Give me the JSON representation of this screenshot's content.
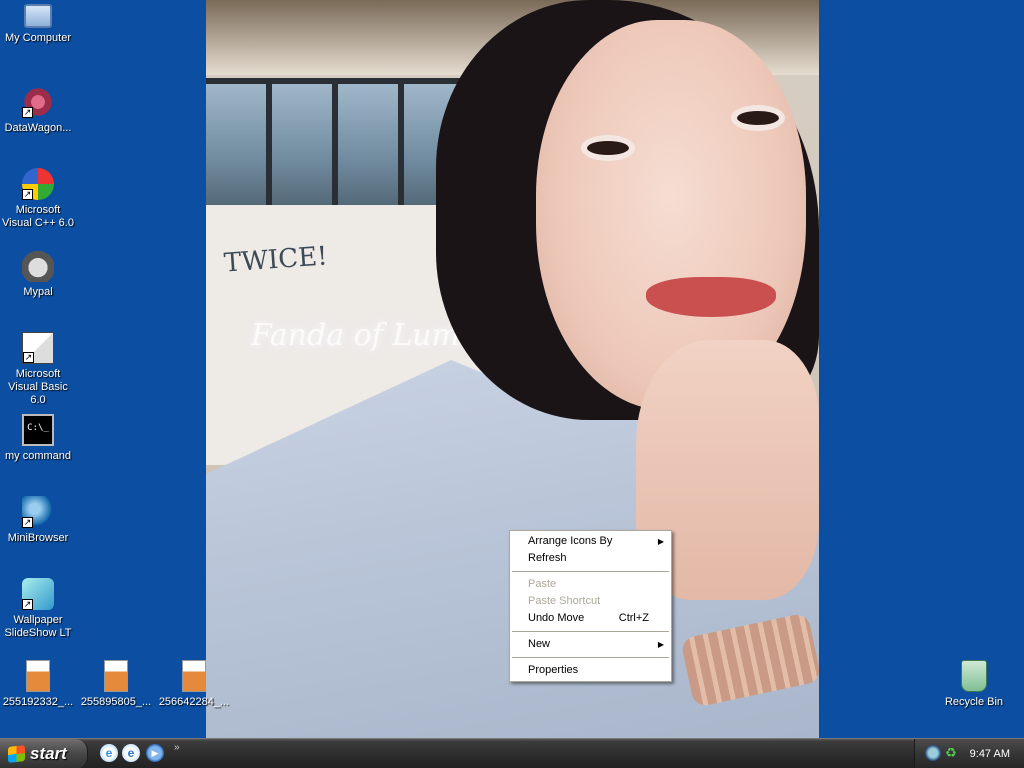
{
  "desktop": {
    "icons": [
      {
        "label": "My Computer",
        "icon": "my-computer-icon"
      },
      {
        "label": "DataWagon...",
        "icon": "datawagon-icon"
      },
      {
        "label": "Microsoft Visual C++ 6.0",
        "icon": "visual-cpp-icon"
      },
      {
        "label": "Mypal",
        "icon": "mypal-icon"
      },
      {
        "label": "Microsoft Visual Basic 6.0",
        "icon": "visual-basic-icon"
      },
      {
        "label": "my command",
        "icon": "command-prompt-icon"
      },
      {
        "label": "MiniBrowser",
        "icon": "minibrowser-icon"
      },
      {
        "label": "Wallpaper SlideShow LT",
        "icon": "wallpaper-slideshow-icon"
      }
    ],
    "files": [
      {
        "label": "255192332_...",
        "icon": "image-file-icon"
      },
      {
        "label": "255895805_...",
        "icon": "image-file-icon"
      },
      {
        "label": "256642284_...",
        "icon": "image-file-icon"
      }
    ],
    "recycle_bin": {
      "label": "Recycle Bin",
      "icon": "recycle-bin-icon"
    },
    "wallpaper": {
      "board_text": "TWICE!",
      "neon_text": "Fanda of Lum..."
    }
  },
  "context_menu": {
    "items": [
      {
        "label": "Arrange Icons By",
        "submenu": true,
        "enabled": true
      },
      {
        "label": "Refresh",
        "enabled": true
      },
      {
        "label": "Paste",
        "enabled": false
      },
      {
        "label": "Paste Shortcut",
        "enabled": false
      },
      {
        "label": "Undo Move",
        "shortcut": "Ctrl+Z",
        "enabled": true
      },
      {
        "label": "New",
        "submenu": true,
        "enabled": true
      },
      {
        "label": "Properties",
        "enabled": true
      }
    ]
  },
  "taskbar": {
    "start_label": "start",
    "quick_launch": [
      {
        "name": "internet-explorer-icon",
        "glyph": "e"
      },
      {
        "name": "browser-icon",
        "glyph": "e"
      },
      {
        "name": "media-player-icon",
        "glyph": "▶"
      }
    ],
    "overflow_glyph": "»",
    "clock": "9:47 AM"
  },
  "colors": {
    "desktop_background": "#0b4ea2",
    "taskbar": "#2e2e2e",
    "menu_disabled": "#aca899"
  }
}
